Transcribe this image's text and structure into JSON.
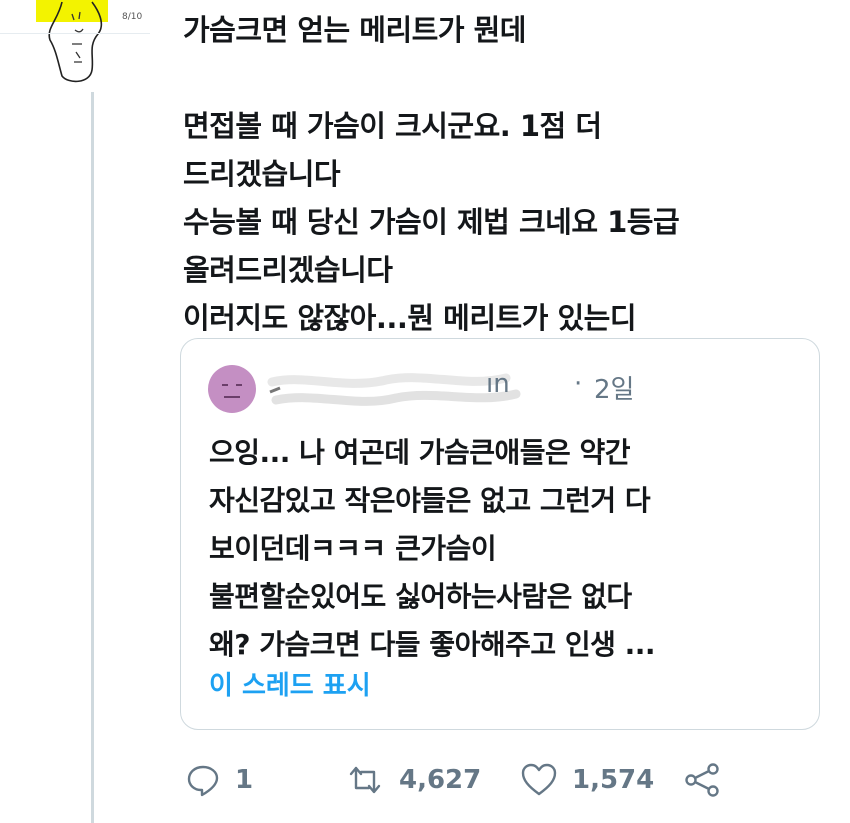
{
  "avatar": {
    "icon": "sketch-avatar-icon",
    "badge": "8/10",
    "accent": "#f3f300"
  },
  "tweet": {
    "text": "가슴크면 얻는 메리트가 뭔데\n\n면접볼 때 가슴이 크시군요. 1점 더\n드리겠습니다\n수능볼 때 당신 가슴이 제법 크네요 1등급\n올려드리겠습니다\n이러지도 않잖아...뭔 메리트가 있는디"
  },
  "quote": {
    "avatar_icon": "face-avatar-icon",
    "handle_tail": "ın",
    "separator": "·",
    "time": "2일",
    "text": "으잉... 나 여곤데 가슴큰애들은 약간\n자신감있고 작은야들은 없고 그런거 다\n보이던데ㅋㅋㅋ 큰가슴이\n불편할순있어도 싫어하는사람은 없다\n왜? 가슴크면  다들 좋아해주고 인생 ...",
    "thread_link": "이 스레드 표시"
  },
  "actions": {
    "reply_count": "1",
    "retweet_count": "4,627",
    "like_count": "1,574"
  },
  "colors": {
    "link": "#1da1f2",
    "muted": "#657786",
    "border": "#cfd9de"
  }
}
